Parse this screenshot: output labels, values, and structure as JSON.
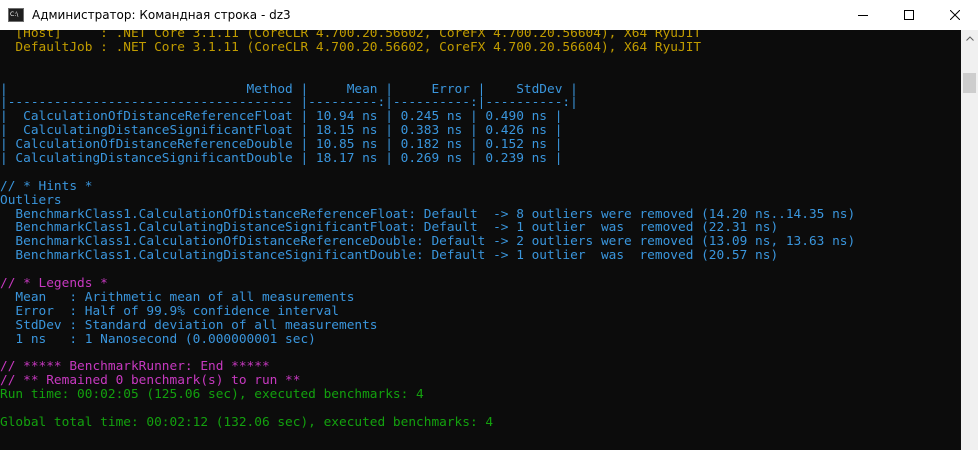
{
  "window": {
    "title": "Администратор: Командная строка - dz3",
    "icon": "cmd-icon",
    "controls": [
      "minimize-icon",
      "maximize-icon",
      "close-icon"
    ]
  },
  "console": {
    "lines": [
      {
        "text": "  [Host]     : .NET Core 3.1.11 (CoreCLR 4.700.20.56602, CoreFX 4.700.20.56604), X64 RyuJIT",
        "color": "yellow"
      },
      {
        "text": "  DefaultJob : .NET Core 3.1.11 (CoreCLR 4.700.20.56602, CoreFX 4.700.20.56604), X64 RyuJIT",
        "color": "yellow"
      },
      {
        "text": "",
        "color": "white"
      },
      {
        "text": "",
        "color": "white"
      },
      {
        "text": "|                               Method |     Mean |     Error |    StdDev |",
        "color": "teal"
      },
      {
        "text": "|------------------------------------- |---------:|----------:|----------:|",
        "color": "teal"
      },
      {
        "text": "|  CalculationOfDistanceReferenceFloat | 10.94 ns | 0.245 ns | 0.490 ns |",
        "color": "teal"
      },
      {
        "text": "|  CalculatingDistanceSignificantFloat | 18.15 ns | 0.383 ns | 0.426 ns |",
        "color": "teal"
      },
      {
        "text": "| CalculationOfDistanceReferenceDouble | 10.85 ns | 0.182 ns | 0.152 ns |",
        "color": "teal"
      },
      {
        "text": "| CalculatingDistanceSignificantDouble | 18.17 ns | 0.269 ns | 0.239 ns |",
        "color": "teal"
      },
      {
        "text": "",
        "color": "white"
      },
      {
        "text": "// * Hints *",
        "color": "cyan"
      },
      {
        "text": "Outliers",
        "color": "cyan"
      },
      {
        "text": "  BenchmarkClass1.CalculationOfDistanceReferenceFloat: Default  -> 8 outliers were removed (14.20 ns..14.35 ns)",
        "color": "cyan"
      },
      {
        "text": "  BenchmarkClass1.CalculatingDistanceSignificantFloat: Default  -> 1 outlier  was  removed (22.31 ns)",
        "color": "cyan"
      },
      {
        "text": "  BenchmarkClass1.CalculationOfDistanceReferenceDouble: Default -> 2 outliers were removed (13.09 ns, 13.63 ns)",
        "color": "cyan"
      },
      {
        "text": "  BenchmarkClass1.CalculatingDistanceSignificantDouble: Default -> 1 outlier  was  removed (20.57 ns)",
        "color": "cyan"
      },
      {
        "text": "",
        "color": "white"
      },
      {
        "text": "// * Legends *",
        "color": "magenta"
      },
      {
        "text": "  Mean   : Arithmetic mean of all measurements",
        "color": "cyan"
      },
      {
        "text": "  Error  : Half of 99.9% confidence interval",
        "color": "cyan"
      },
      {
        "text": "  StdDev : Standard deviation of all measurements",
        "color": "cyan"
      },
      {
        "text": "  1 ns   : 1 Nanosecond (0.000000001 sec)",
        "color": "cyan"
      },
      {
        "text": "",
        "color": "white"
      },
      {
        "text": "// ***** BenchmarkRunner: End *****",
        "color": "magenta"
      },
      {
        "text": "// ** Remained 0 benchmark(s) to run **",
        "color": "magenta"
      },
      {
        "text": "Run time: 00:02:05 (125.06 sec), executed benchmarks: 4",
        "color": "green"
      },
      {
        "text": "",
        "color": "white"
      },
      {
        "text": "Global total time: 00:02:12 (132.06 sec), executed benchmarks: 4",
        "color": "green"
      }
    ]
  },
  "colors": {
    "background": "#0c0c0c",
    "yellow": "#c19c00",
    "cyan": "#3a96dd",
    "teal": "#3a96dd",
    "green": "#13a10e",
    "magenta": "#c739c0",
    "white": "#cccccc"
  }
}
